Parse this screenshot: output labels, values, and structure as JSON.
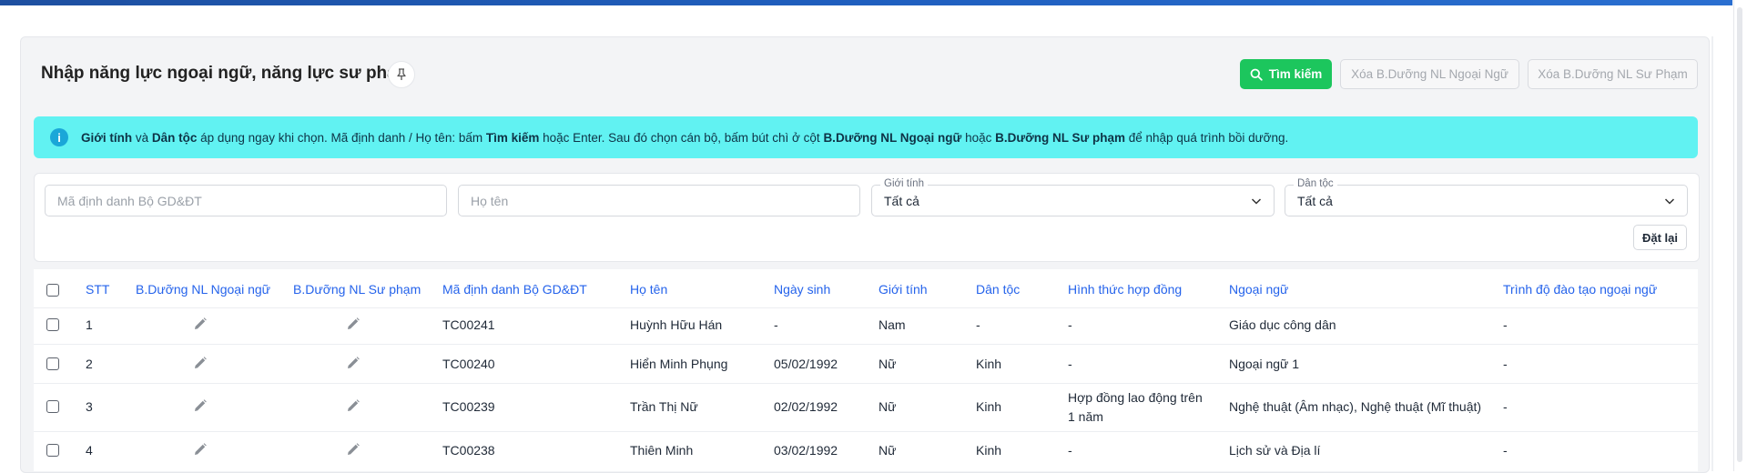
{
  "page": {
    "title": "Nhập năng lực ngoại ngữ, năng lực sư phạm",
    "pin_icon": "pin-icon"
  },
  "toolbar": {
    "search_label": "Tìm kiếm",
    "delete_foreign_label": "Xóa B.Dưỡng NL Ngoại Ngữ",
    "delete_pedagogy_label": "Xóa B.Dưỡng NL Sư Phạm",
    "search_color": "#1cc65d"
  },
  "alert": {
    "icon": "info-icon",
    "t1": "Giới tính",
    "t2": " và ",
    "t3": "Dân tộc",
    "t4": " áp dụng ngay khi chọn. Mã định danh / Họ tên: bấm ",
    "t5": "Tìm kiếm",
    "t6": " hoặc Enter. Sau đó chọn cán bộ, bấm bút chì ở cột ",
    "t7": "B.Dưỡng NL Ngoại ngữ",
    "t8": " hoặc ",
    "t9": "B.Dưỡng NL Sư phạm",
    "t10": " để nhập quá trình bồi dưỡng.",
    "bg_color": "#61f2f2"
  },
  "filters": {
    "id_placeholder": "Mã định danh Bộ GD&ĐT",
    "name_placeholder": "Họ tên",
    "gender_label": "Giới tính",
    "gender_value": "Tất cả",
    "ethnicity_label": "Dân tộc",
    "ethnicity_value": "Tất cả",
    "reset_label": "Đặt lại"
  },
  "table": {
    "headers": {
      "stt": "STT",
      "foreign": "B.Dưỡng NL Ngoại ngữ",
      "pedagogy": "B.Dưỡng NL Sư phạm",
      "id": "Mã định danh Bộ GD&ĐT",
      "name": "Họ tên",
      "dob": "Ngày sinh",
      "gender": "Giới tính",
      "ethnicity": "Dân tộc",
      "contract": "Hình thức hợp đồng",
      "language": "Ngoại ngữ",
      "level": "Trình độ đào tạo ngoại ngữ"
    },
    "header_color": "#2563eb",
    "rows": [
      {
        "stt": "1",
        "id": "TC00241",
        "name": "Huỳnh Hữu Hán",
        "dob": "-",
        "gender": "Nam",
        "ethnicity": "-",
        "contract_1": "-",
        "contract_2": "",
        "language": "Giáo dục công dân",
        "level": "-"
      },
      {
        "stt": "2",
        "id": "TC00240",
        "name": "Hiển Minh Phụng",
        "dob": "05/02/1992",
        "gender": "Nữ",
        "ethnicity": "Kinh",
        "contract_1": "-",
        "contract_2": "",
        "language": "Ngoại ngữ 1",
        "level": "-"
      },
      {
        "stt": "3",
        "id": "TC00239",
        "name": "Trần Thị Nữ",
        "dob": "02/02/1992",
        "gender": "Nữ",
        "ethnicity": "Kinh",
        "contract_1": "Hợp đồng lao động trên",
        "contract_2": "1 năm",
        "language": "Nghệ thuật (Âm nhạc), Nghệ thuật (Mĩ thuật)",
        "level": "-"
      },
      {
        "stt": "4",
        "id": "TC00238",
        "name": "Thiên Minh",
        "dob": "03/02/1992",
        "gender": "Nữ",
        "ethnicity": "Kinh",
        "contract_1": "-",
        "contract_2": "",
        "language": "Lịch sử và Địa lí",
        "level": "-"
      }
    ]
  }
}
